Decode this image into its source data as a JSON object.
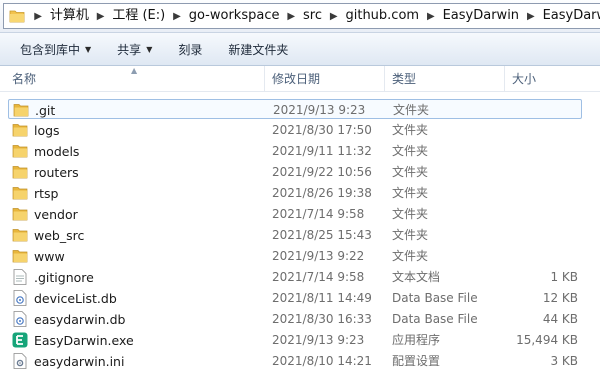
{
  "address": {
    "crumbs": [
      "计算机",
      "工程 (E:)",
      "go-workspace",
      "src",
      "github.com",
      "EasyDarwin",
      "EasyDarwin"
    ]
  },
  "toolbar": {
    "include_library": "包含到库中",
    "share": "共享",
    "burn": "刻录",
    "new_folder": "新建文件夹"
  },
  "columns": {
    "name": "名称",
    "date": "修改日期",
    "type": "类型",
    "size": "大小"
  },
  "files": [
    {
      "name": ".git",
      "date": "2021/9/13 9:23",
      "type": "文件夹",
      "size": "",
      "icon": "folder-icon"
    },
    {
      "name": "logs",
      "date": "2021/8/30 17:50",
      "type": "文件夹",
      "size": "",
      "icon": "folder-icon"
    },
    {
      "name": "models",
      "date": "2021/9/11 11:32",
      "type": "文件夹",
      "size": "",
      "icon": "folder-icon"
    },
    {
      "name": "routers",
      "date": "2021/9/22 10:56",
      "type": "文件夹",
      "size": "",
      "icon": "folder-icon"
    },
    {
      "name": "rtsp",
      "date": "2021/8/26 19:38",
      "type": "文件夹",
      "size": "",
      "icon": "folder-icon"
    },
    {
      "name": "vendor",
      "date": "2021/7/14 9:58",
      "type": "文件夹",
      "size": "",
      "icon": "folder-icon"
    },
    {
      "name": "web_src",
      "date": "2021/8/25 15:43",
      "type": "文件夹",
      "size": "",
      "icon": "folder-icon"
    },
    {
      "name": "www",
      "date": "2021/9/13 9:22",
      "type": "文件夹",
      "size": "",
      "icon": "folder-icon"
    },
    {
      "name": ".gitignore",
      "date": "2021/7/14 9:58",
      "type": "文本文档",
      "size": "1 KB",
      "icon": "text-file-icon"
    },
    {
      "name": "deviceList.db",
      "date": "2021/8/11 14:49",
      "type": "Data Base File",
      "size": "12 KB",
      "icon": "database-file-icon"
    },
    {
      "name": "easydarwin.db",
      "date": "2021/8/30 16:33",
      "type": "Data Base File",
      "size": "44 KB",
      "icon": "database-file-icon"
    },
    {
      "name": "EasyDarwin.exe",
      "date": "2021/9/13 9:23",
      "type": "应用程序",
      "size": "15,494 KB",
      "icon": "exe-app-icon"
    },
    {
      "name": "easydarwin.ini",
      "date": "2021/8/10 14:21",
      "type": "配置设置",
      "size": "3 KB",
      "icon": "ini-settings-icon"
    }
  ],
  "colors": {
    "folder": "#f2c34e",
    "exe_accent": "#17a57a",
    "selection_border": "#9fbfe4"
  }
}
